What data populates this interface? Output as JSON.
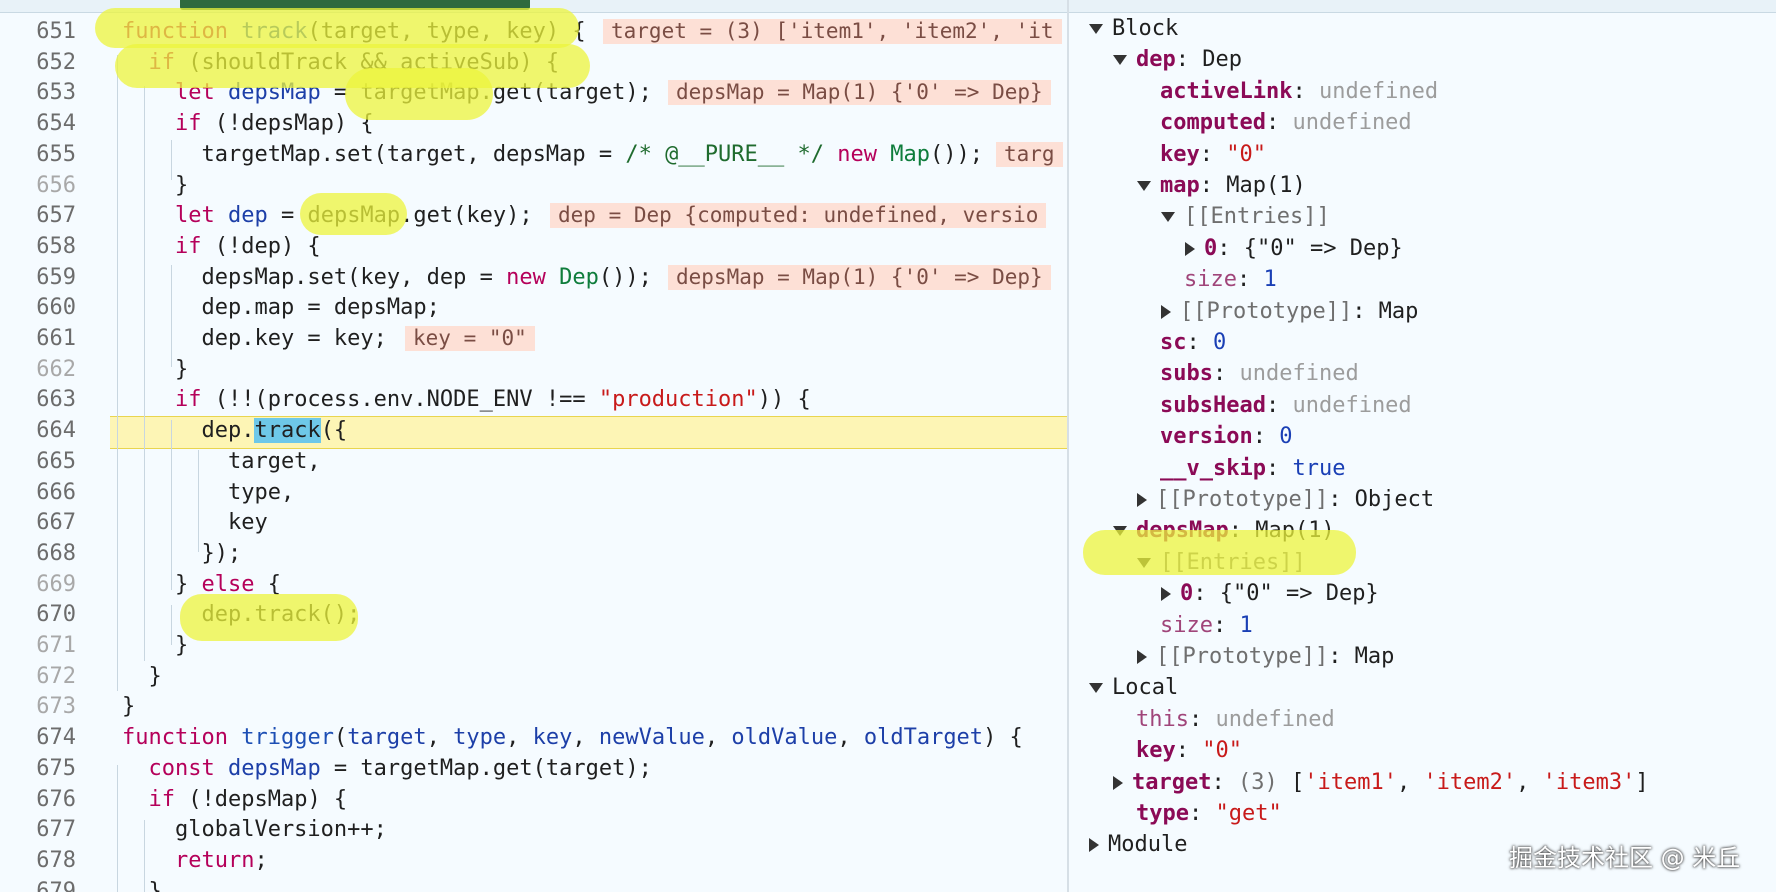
{
  "editor": {
    "lines": [
      {
        "num": "651",
        "tokens": [
          {
            "t": "function ",
            "c": "kw"
          },
          {
            "t": "track",
            "c": "fn"
          },
          {
            "t": "(target, type, key) {",
            "c": ""
          }
        ],
        "inline": "target = (3) ['item1', 'item2', 'it"
      },
      {
        "num": "652",
        "tokens": [
          {
            "t": "  if ",
            "c": "kw"
          },
          {
            "t": "(shouldTrack && activeSub) {",
            "c": ""
          }
        ],
        "inline": ""
      },
      {
        "num": "653",
        "tokens": [
          {
            "t": "    let ",
            "c": "kw"
          },
          {
            "t": "depsMap",
            "c": "var"
          },
          {
            "t": " = targetMap.get(target);",
            "c": ""
          }
        ],
        "inline": "depsMap = Map(1) {'0' => Dep}"
      },
      {
        "num": "654",
        "tokens": [
          {
            "t": "    if ",
            "c": "kw"
          },
          {
            "t": "(!depsMap) {",
            "c": ""
          }
        ],
        "inline": ""
      },
      {
        "num": "655",
        "tokens": [
          {
            "t": "      targetMap.set(target, depsMap = ",
            "c": ""
          },
          {
            "t": "/* @__PURE__ */",
            "c": "cmt"
          },
          {
            "t": " ",
            "c": ""
          },
          {
            "t": "new ",
            "c": "kw"
          },
          {
            "t": "Map",
            "c": "cls"
          },
          {
            "t": "());",
            "c": ""
          }
        ],
        "inline": "targ"
      },
      {
        "num": "656",
        "tokens": [
          {
            "t": "    }",
            "c": ""
          }
        ],
        "inline": ""
      },
      {
        "num": "657",
        "tokens": [
          {
            "t": "    let ",
            "c": "kw"
          },
          {
            "t": "dep",
            "c": "var"
          },
          {
            "t": " = depsMap.get(key);",
            "c": ""
          }
        ],
        "inline": "dep = Dep {computed: undefined, versio"
      },
      {
        "num": "658",
        "tokens": [
          {
            "t": "    if ",
            "c": "kw"
          },
          {
            "t": "(!dep) {",
            "c": ""
          }
        ],
        "inline": ""
      },
      {
        "num": "659",
        "tokens": [
          {
            "t": "      depsMap.set(key, dep = ",
            "c": ""
          },
          {
            "t": "new ",
            "c": "kw"
          },
          {
            "t": "Dep",
            "c": "cls"
          },
          {
            "t": "());",
            "c": ""
          }
        ],
        "inline": "depsMap = Map(1) {'0' => Dep}"
      },
      {
        "num": "660",
        "tokens": [
          {
            "t": "      dep.map = depsMap;",
            "c": ""
          }
        ],
        "inline": ""
      },
      {
        "num": "661",
        "tokens": [
          {
            "t": "      dep.key = key;",
            "c": ""
          }
        ],
        "inline": "key = \"0\""
      },
      {
        "num": "662",
        "tokens": [
          {
            "t": "    }",
            "c": ""
          }
        ],
        "inline": ""
      },
      {
        "num": "663",
        "tokens": [
          {
            "t": "    if ",
            "c": "kw"
          },
          {
            "t": "(!!(process.env.NODE_ENV !== ",
            "c": ""
          },
          {
            "t": "\"production\"",
            "c": "str"
          },
          {
            "t": ")) {",
            "c": ""
          }
        ],
        "inline": ""
      },
      {
        "num": "664",
        "tokens": [
          {
            "t": "      dep.",
            "c": ""
          },
          {
            "t": "track",
            "c": "sel"
          },
          {
            "t": "({",
            "c": ""
          }
        ],
        "inline": ""
      },
      {
        "num": "665",
        "tokens": [
          {
            "t": "        target,",
            "c": ""
          }
        ],
        "inline": ""
      },
      {
        "num": "666",
        "tokens": [
          {
            "t": "        type,",
            "c": ""
          }
        ],
        "inline": ""
      },
      {
        "num": "667",
        "tokens": [
          {
            "t": "        key",
            "c": ""
          }
        ],
        "inline": ""
      },
      {
        "num": "668",
        "tokens": [
          {
            "t": "      });",
            "c": ""
          }
        ],
        "inline": ""
      },
      {
        "num": "669",
        "tokens": [
          {
            "t": "    } ",
            "c": ""
          },
          {
            "t": "else ",
            "c": "kw"
          },
          {
            "t": "{",
            "c": ""
          }
        ],
        "inline": ""
      },
      {
        "num": "670",
        "tokens": [
          {
            "t": "      dep.track();",
            "c": ""
          }
        ],
        "inline": ""
      },
      {
        "num": "671",
        "tokens": [
          {
            "t": "    }",
            "c": ""
          }
        ],
        "inline": ""
      },
      {
        "num": "672",
        "tokens": [
          {
            "t": "  }",
            "c": ""
          }
        ],
        "inline": ""
      },
      {
        "num": "673",
        "tokens": [
          {
            "t": "}",
            "c": ""
          }
        ],
        "inline": ""
      },
      {
        "num": "674",
        "tokens": [
          {
            "t": "function ",
            "c": "kw"
          },
          {
            "t": "trigger",
            "c": "fn"
          },
          {
            "t": "(",
            "c": ""
          },
          {
            "t": "target",
            "c": "var"
          },
          {
            "t": ", ",
            "c": ""
          },
          {
            "t": "type",
            "c": "var"
          },
          {
            "t": ", ",
            "c": ""
          },
          {
            "t": "key",
            "c": "var"
          },
          {
            "t": ", ",
            "c": ""
          },
          {
            "t": "newValue",
            "c": "var"
          },
          {
            "t": ", ",
            "c": ""
          },
          {
            "t": "oldValue",
            "c": "var"
          },
          {
            "t": ", ",
            "c": ""
          },
          {
            "t": "oldTarget",
            "c": "var"
          },
          {
            "t": ") {",
            "c": ""
          }
        ],
        "inline": ""
      },
      {
        "num": "675",
        "tokens": [
          {
            "t": "  const ",
            "c": "kw"
          },
          {
            "t": "depsMap",
            "c": "var"
          },
          {
            "t": " = targetMap.get(target);",
            "c": ""
          }
        ],
        "inline": ""
      },
      {
        "num": "676",
        "tokens": [
          {
            "t": "  if ",
            "c": "kw"
          },
          {
            "t": "(!depsMap) {",
            "c": ""
          }
        ],
        "inline": ""
      },
      {
        "num": "677",
        "tokens": [
          {
            "t": "    globalVersion++;",
            "c": ""
          }
        ],
        "inline": ""
      },
      {
        "num": "678",
        "tokens": [
          {
            "t": "    return",
            "c": "kw"
          },
          {
            "t": ";",
            "c": ""
          }
        ],
        "inline": ""
      },
      {
        "num": "679",
        "tokens": [
          {
            "t": "  }",
            "c": ""
          }
        ],
        "inline": ""
      }
    ]
  },
  "scope": {
    "rows": [
      {
        "indent": 0,
        "toggle": "down",
        "parts": [
          {
            "t": "Block",
            "c": ""
          }
        ]
      },
      {
        "indent": 1,
        "toggle": "down",
        "parts": [
          {
            "t": "dep",
            "c": "prop"
          },
          {
            "t": ": Dep",
            "c": ""
          }
        ]
      },
      {
        "indent": 2,
        "toggle": "",
        "parts": [
          {
            "t": "activeLink",
            "c": "prop"
          },
          {
            "t": ": ",
            "c": ""
          },
          {
            "t": "undefined",
            "c": "undef"
          }
        ]
      },
      {
        "indent": 2,
        "toggle": "",
        "parts": [
          {
            "t": "computed",
            "c": "prop"
          },
          {
            "t": ": ",
            "c": ""
          },
          {
            "t": "undefined",
            "c": "undef"
          }
        ]
      },
      {
        "indent": 2,
        "toggle": "",
        "parts": [
          {
            "t": "key",
            "c": "prop"
          },
          {
            "t": ": ",
            "c": ""
          },
          {
            "t": "\"0\"",
            "c": "sval"
          }
        ]
      },
      {
        "indent": 2,
        "toggle": "down",
        "parts": [
          {
            "t": "map",
            "c": "prop"
          },
          {
            "t": ": Map(1)",
            "c": ""
          }
        ]
      },
      {
        "indent": 3,
        "toggle": "down",
        "parts": [
          {
            "t": "[[Entries]]",
            "c": "internal"
          }
        ]
      },
      {
        "indent": 4,
        "toggle": "right",
        "parts": [
          {
            "t": "0",
            "c": "prop"
          },
          {
            "t": ": {\"0\" => Dep}",
            "c": ""
          }
        ]
      },
      {
        "indent": 3,
        "toggle": "",
        "parts": [
          {
            "t": "size",
            "c": "prop-dim"
          },
          {
            "t": ": ",
            "c": ""
          },
          {
            "t": "1",
            "c": "num"
          }
        ]
      },
      {
        "indent": 3,
        "toggle": "right",
        "parts": [
          {
            "t": "[[Prototype]]",
            "c": "internal"
          },
          {
            "t": ": Map",
            "c": ""
          }
        ]
      },
      {
        "indent": 2,
        "toggle": "",
        "parts": [
          {
            "t": "sc",
            "c": "prop"
          },
          {
            "t": ": ",
            "c": ""
          },
          {
            "t": "0",
            "c": "num"
          }
        ]
      },
      {
        "indent": 2,
        "toggle": "",
        "parts": [
          {
            "t": "subs",
            "c": "prop"
          },
          {
            "t": ": ",
            "c": ""
          },
          {
            "t": "undefined",
            "c": "undef"
          }
        ]
      },
      {
        "indent": 2,
        "toggle": "",
        "parts": [
          {
            "t": "subsHead",
            "c": "prop"
          },
          {
            "t": ": ",
            "c": ""
          },
          {
            "t": "undefined",
            "c": "undef"
          }
        ]
      },
      {
        "indent": 2,
        "toggle": "",
        "parts": [
          {
            "t": "version",
            "c": "prop"
          },
          {
            "t": ": ",
            "c": ""
          },
          {
            "t": "0",
            "c": "num"
          }
        ]
      },
      {
        "indent": 2,
        "toggle": "",
        "parts": [
          {
            "t": "__v_skip",
            "c": "prop"
          },
          {
            "t": ": ",
            "c": ""
          },
          {
            "t": "true",
            "c": "num"
          }
        ]
      },
      {
        "indent": 2,
        "toggle": "right",
        "parts": [
          {
            "t": "[[Prototype]]",
            "c": "internal"
          },
          {
            "t": ": Object",
            "c": ""
          }
        ]
      },
      {
        "indent": 1,
        "toggle": "down",
        "parts": [
          {
            "t": "depsMap",
            "c": "prop"
          },
          {
            "t": ": Map(1)",
            "c": ""
          }
        ]
      },
      {
        "indent": 2,
        "toggle": "down",
        "parts": [
          {
            "t": "[[Entries]]",
            "c": "internal"
          }
        ]
      },
      {
        "indent": 3,
        "toggle": "right",
        "parts": [
          {
            "t": "0",
            "c": "prop"
          },
          {
            "t": ": {\"0\" => Dep}",
            "c": ""
          }
        ]
      },
      {
        "indent": 2,
        "toggle": "",
        "parts": [
          {
            "t": "size",
            "c": "prop-dim"
          },
          {
            "t": ": ",
            "c": ""
          },
          {
            "t": "1",
            "c": "num"
          }
        ]
      },
      {
        "indent": 2,
        "toggle": "right",
        "parts": [
          {
            "t": "[[Prototype]]",
            "c": "internal"
          },
          {
            "t": ": Map",
            "c": ""
          }
        ]
      },
      {
        "indent": 0,
        "toggle": "down",
        "parts": [
          {
            "t": "Local",
            "c": ""
          }
        ]
      },
      {
        "indent": 1,
        "toggle": "",
        "parts": [
          {
            "t": "this",
            "c": "prop-dim"
          },
          {
            "t": ": ",
            "c": ""
          },
          {
            "t": "undefined",
            "c": "undef"
          }
        ]
      },
      {
        "indent": 1,
        "toggle": "",
        "parts": [
          {
            "t": "key",
            "c": "prop"
          },
          {
            "t": ": ",
            "c": ""
          },
          {
            "t": "\"0\"",
            "c": "sval"
          }
        ]
      },
      {
        "indent": 1,
        "toggle": "right",
        "parts": [
          {
            "t": "target",
            "c": "prop"
          },
          {
            "t": ": ",
            "c": ""
          },
          {
            "t": "(3) ",
            "c": "cnt"
          },
          {
            "t": "[",
            "c": ""
          },
          {
            "t": "'item1'",
            "c": "sval"
          },
          {
            "t": ", ",
            "c": ""
          },
          {
            "t": "'item2'",
            "c": "sval"
          },
          {
            "t": ", ",
            "c": ""
          },
          {
            "t": "'item3'",
            "c": "sval"
          },
          {
            "t": "]",
            "c": ""
          }
        ]
      },
      {
        "indent": 1,
        "toggle": "",
        "parts": [
          {
            "t": "type",
            "c": "prop"
          },
          {
            "t": ": ",
            "c": ""
          },
          {
            "t": "\"get\"",
            "c": "sval"
          }
        ]
      },
      {
        "indent": 0,
        "toggle": "right",
        "parts": [
          {
            "t": "Module",
            "c": ""
          }
        ]
      }
    ]
  },
  "watermark": "掘金技术社区 @ 米丘"
}
